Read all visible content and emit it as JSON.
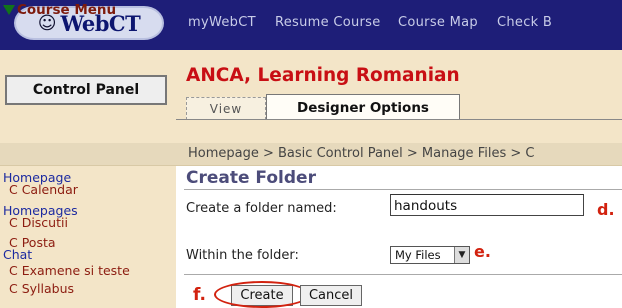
{
  "header": {
    "logo_text": "WebCT",
    "nav_items": [
      "myWebCT",
      "Resume Course",
      "Course Map",
      "Check B"
    ]
  },
  "sidebar": {
    "control_panel_label": "Control Panel",
    "course_menu_label": "Course Menu",
    "menu_items": [
      {
        "label": "Homepage",
        "kind": "link"
      },
      {
        "label": "C Calendar",
        "kind": "item"
      },
      {
        "label": "Homepages",
        "kind": "link"
      },
      {
        "label": "C Discutii",
        "kind": "item"
      },
      {
        "label": "C Posta",
        "kind": "item"
      },
      {
        "label": "Chat",
        "kind": "link"
      },
      {
        "label": "C Examene si teste",
        "kind": "item"
      },
      {
        "label": "C Syllabus",
        "kind": "item"
      }
    ]
  },
  "course": {
    "title": "ANCA, Learning Romanian",
    "tabs": [
      {
        "label": "View",
        "active": false
      },
      {
        "label": "Designer Options",
        "active": true
      }
    ]
  },
  "breadcrumb": "Homepage > Basic Control Panel > Manage Files > C",
  "form": {
    "title": "Create Folder",
    "folder_name_label": "Create a folder named:",
    "folder_name_value": "handouts",
    "within_label": "Within the folder:",
    "within_value": "My Files",
    "create_label": "Create",
    "cancel_label": "Cancel"
  },
  "annotations": {
    "d": "d.",
    "e": "e.",
    "f": "f."
  },
  "colors": {
    "top_bar": "#1e1e78",
    "panel_bg": "#f3e5c8",
    "course_title": "#c80f14",
    "annotation_red": "#d2220f",
    "link_blue": "#1c2aa0",
    "menu_item_red": "#8c1c10"
  }
}
